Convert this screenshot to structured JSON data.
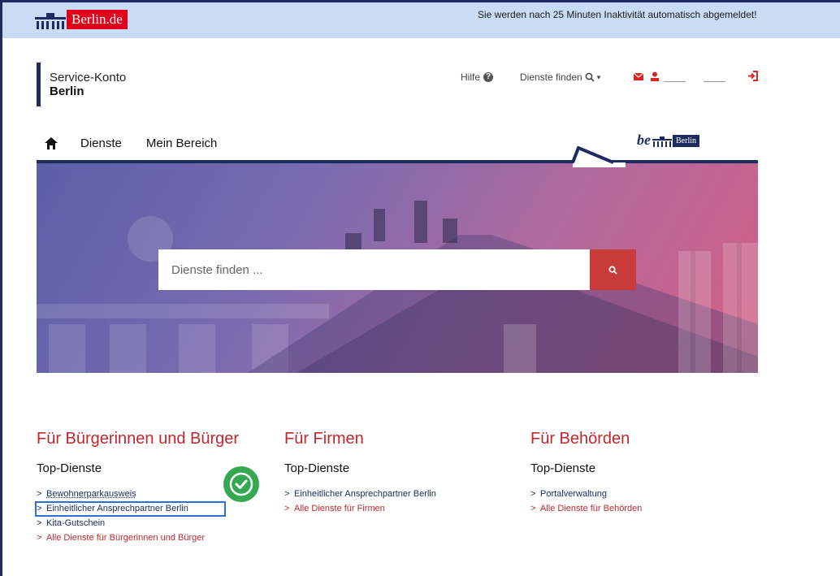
{
  "topbar": {
    "brand": "Berlin.de",
    "notice": "Sie werden nach 25 Minuten Inaktivität automatisch abgemeldet!"
  },
  "header": {
    "title": "Service-Konto",
    "subtitle": "Berlin",
    "help_label": "Hilfe",
    "find_label": "Dienste finden",
    "icons": [
      "envelope-icon",
      "user-icon",
      "logout-icon"
    ]
  },
  "nav": {
    "home_icon": "home-icon",
    "items": [
      "Dienste",
      "Mein Bereich"
    ],
    "be_logo_text": "be",
    "be_logo_badge": "Berlin"
  },
  "hero": {
    "search_placeholder": "Dienste finden ..."
  },
  "columns": [
    {
      "heading": "Für Bürgerinnen und Bürger",
      "subheading": "Top-Dienste",
      "links": [
        "Bewohnerparkausweis",
        "Einheitlicher Ansprechpartner Berlin",
        "Kita-Gutschein"
      ],
      "all_link": "Alle Dienste für Bürgerinnen und Bürger"
    },
    {
      "heading": "Für Firmen",
      "subheading": "Top-Dienste",
      "links": [
        "Einheitlicher Ansprechpartner Berlin"
      ],
      "all_link": "Alle Dienste für Firmen"
    },
    {
      "heading": "Für Behörden",
      "subheading": "Top-Dienste",
      "links": [
        "Portalverwaltung"
      ],
      "all_link": "Alle Dienste für Behörden"
    }
  ],
  "colors": {
    "accent_red": "#c0282d",
    "navy": "#1d2b5e",
    "highlight_blue": "#2f6fd6",
    "check_green": "#34a853"
  }
}
